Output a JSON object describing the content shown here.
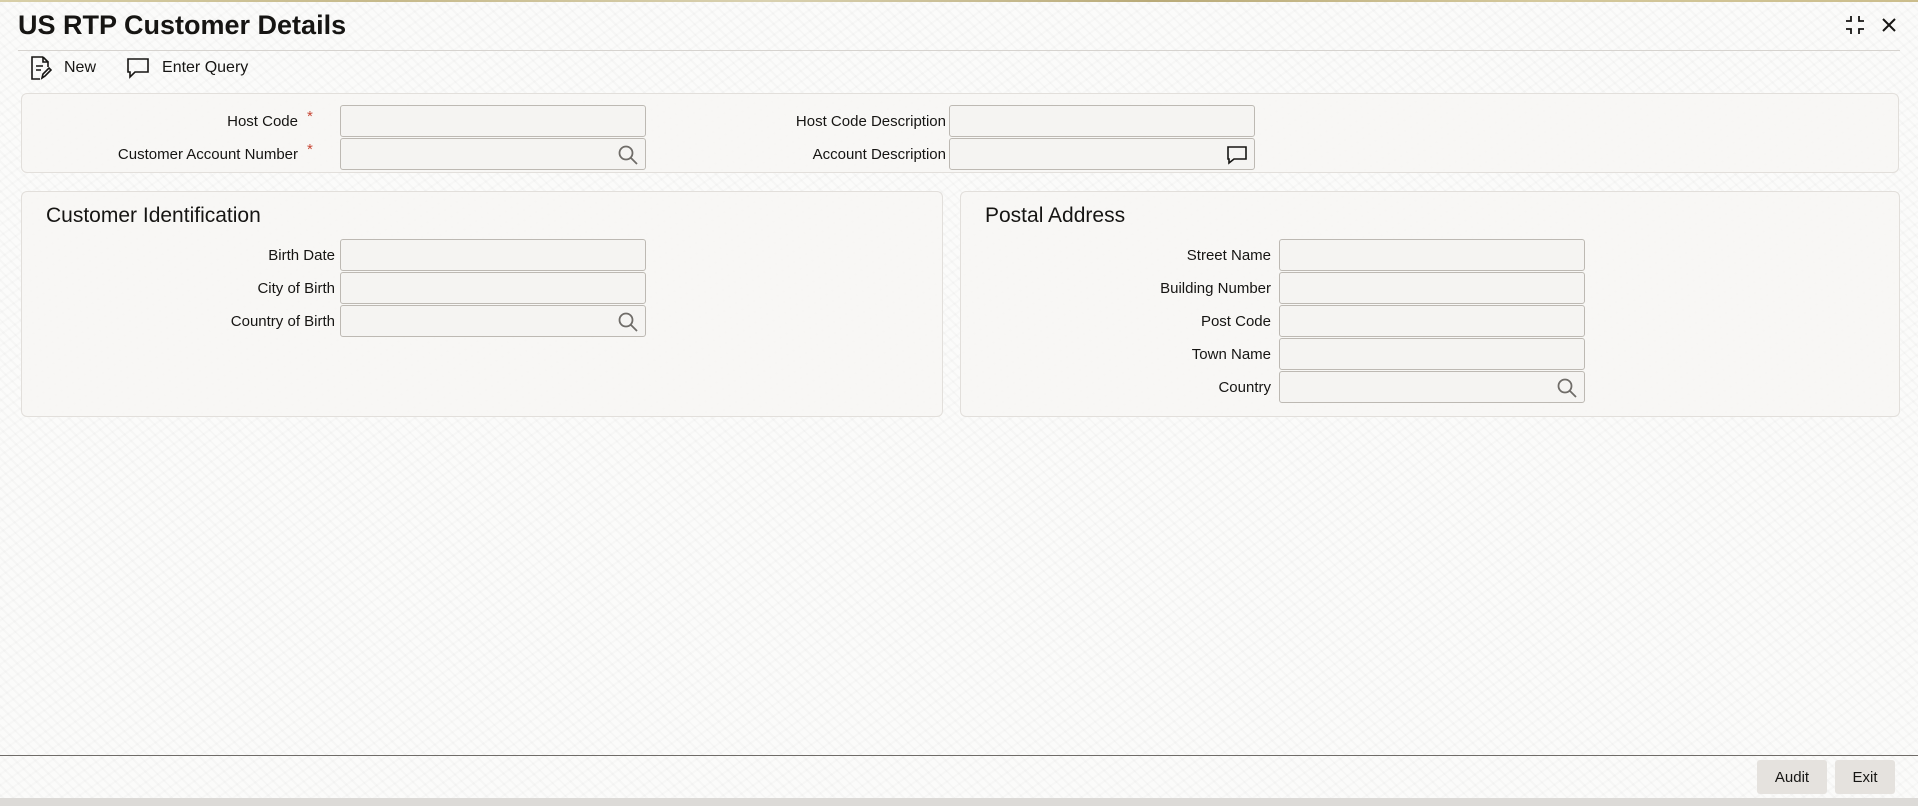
{
  "window": {
    "title": "US RTP Customer Details",
    "controls": [
      {
        "name": "maximize-icon"
      },
      {
        "name": "close-icon"
      }
    ]
  },
  "toolbar": {
    "new_label": "New",
    "new_icon": "document-edit-icon",
    "enter_query_label": "Enter Query",
    "enter_query_icon": "speech-bubble-icon"
  },
  "header_fields": {
    "host_code": {
      "label": "Host Code",
      "required_mark": "*",
      "value": ""
    },
    "customer_account_number": {
      "label": "Customer Account Number",
      "required_mark": "*",
      "value": "",
      "icon": "search-icon"
    },
    "host_code_description": {
      "label": "Host Code Description",
      "value": ""
    },
    "account_description": {
      "label": "Account Description",
      "value": "",
      "icon": "speech-bubble-icon"
    }
  },
  "customer_identification": {
    "title": "Customer Identification",
    "birth_date": {
      "label": "Birth Date",
      "value": ""
    },
    "city_of_birth": {
      "label": "City of Birth",
      "value": ""
    },
    "country_of_birth": {
      "label": "Country of Birth",
      "value": "",
      "icon": "search-icon"
    }
  },
  "postal_address": {
    "title": "Postal Address",
    "street_name": {
      "label": "Street Name",
      "value": ""
    },
    "building_number": {
      "label": "Building Number",
      "value": ""
    },
    "post_code": {
      "label": "Post Code",
      "value": ""
    },
    "town_name": {
      "label": "Town Name",
      "value": ""
    },
    "country": {
      "label": "Country",
      "value": "",
      "icon": "search-icon"
    }
  },
  "footer": {
    "audit_label": "Audit",
    "exit_label": "Exit"
  },
  "colors": {
    "required": "#c74634",
    "text": "#161513",
    "panel_bg": "#f7f6f4",
    "field_border": "#bdb9b3",
    "footer_button_bg": "#e5e2de"
  }
}
